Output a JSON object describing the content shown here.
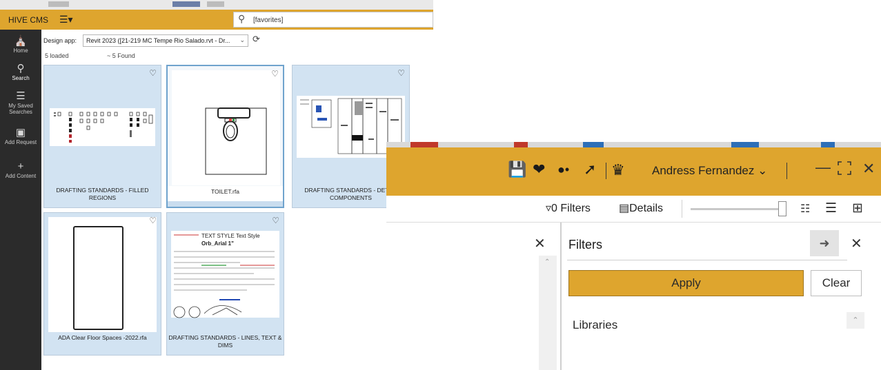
{
  "cms": {
    "title": "HIVE CMS",
    "menu_glyph": "☰▾",
    "search": {
      "value": "[favorites]",
      "placeholder": ""
    },
    "sidebar": [
      {
        "label": "Home",
        "glyph": "⌂",
        "active": false
      },
      {
        "label": "Search",
        "glyph": "⚲",
        "active": true
      },
      {
        "label": "My Saved Searches",
        "glyph": "☰",
        "active": false
      },
      {
        "label": "Add Request",
        "glyph": "▭",
        "active": false
      },
      {
        "label": "Add Content",
        "glyph": "+",
        "active": false
      }
    ],
    "design_app_label": "Design app:",
    "design_app_value": "Revit 2023 ([21-219 MC Tempe Rio Salado.rvt - Dr...",
    "loaded": "5  loaded",
    "found": "~ 5  Found",
    "cards": [
      {
        "label": "DRAFTING STANDARDS - FILLED REGIONS",
        "thumb": "filled-regions",
        "selected": false
      },
      {
        "label": "TOILET.rfa",
        "thumb": "toilet",
        "selected": true
      },
      {
        "label": "DRAFTING STANDARDS - DETAIL COMPONENTS",
        "thumb": "detail-components",
        "selected": false
      },
      {
        "label": "ADA Clear Floor Spaces -2022.rfa",
        "thumb": "ada",
        "selected": false
      },
      {
        "label": "DRAFTING STANDARDS - LINES, TEXT & DIMS",
        "thumb": "lines-text",
        "selected": false
      }
    ],
    "text_style_title": "TEXT STYLE Text Style",
    "text_style_font": "Orb_Arial 1\"",
    "colors": {
      "accent": "#dea52e",
      "sidebar": "#2b2b2b",
      "card": "#d2e3f2"
    }
  },
  "library": {
    "user": "Andress Fernandez",
    "filters_label": "0 Filters",
    "details_label": "Details",
    "filter_panel_title": "Filters",
    "apply_label": "Apply",
    "clear_label": "Clear",
    "libraries_label": "Libraries",
    "zoom_level": 1.0,
    "icons": [
      "save-icon",
      "heart-icon",
      "user-add-icon",
      "pin-icon",
      "crown-icon",
      "minimize-icon",
      "maximize-icon",
      "close-icon"
    ]
  }
}
